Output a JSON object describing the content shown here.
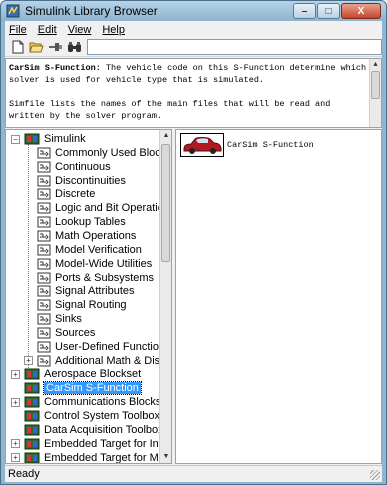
{
  "window": {
    "title": "Simulink Library Browser",
    "controls": {
      "minimize": "–",
      "maximize": "□",
      "close": "X"
    }
  },
  "menu": [
    "File",
    "Edit",
    "View",
    "Help"
  ],
  "toolbar": {
    "icons": [
      "new-model-icon",
      "open-icon",
      "pin-icon",
      "find-icon"
    ],
    "search_value": ""
  },
  "description": {
    "heading": "CarSim S-Function:",
    "line1_rest": " The vehicle code on this S-Function determine which solver is used for vehicle type that is simulated.",
    "para2": "Simfile lists the names of the main files that will be read and written by the solver program."
  },
  "tree": {
    "root": "Simulink",
    "simulink_children": [
      "Commonly Used Blocks",
      "Continuous",
      "Discontinuities",
      "Discrete",
      "Logic and Bit Operations",
      "Lookup Tables",
      "Math Operations",
      "Model Verification",
      "Model-Wide Utilities",
      "Ports & Subsystems",
      "Signal Attributes",
      "Signal Routing",
      "Sinks",
      "Sources",
      "User-Defined Functions",
      "Additional Math & Discrete"
    ],
    "libraries": [
      "Aerospace Blockset",
      "CarSim S-Function",
      "Communications Blockset",
      "Control System Toolbox",
      "Data Acquisition Toolbox",
      "Embedded Target for Infineon",
      "Embedded Target for Motoro",
      "Embedded Target for Motoro"
    ],
    "selected": "CarSim S-Function"
  },
  "blocks": [
    {
      "name": "CarSim S-Function",
      "icon": "red-car-icon"
    }
  ],
  "status": "Ready",
  "colors": {
    "selection": "#3399ff",
    "titlebar": "#9dc0d9",
    "car": "#b11a22"
  }
}
